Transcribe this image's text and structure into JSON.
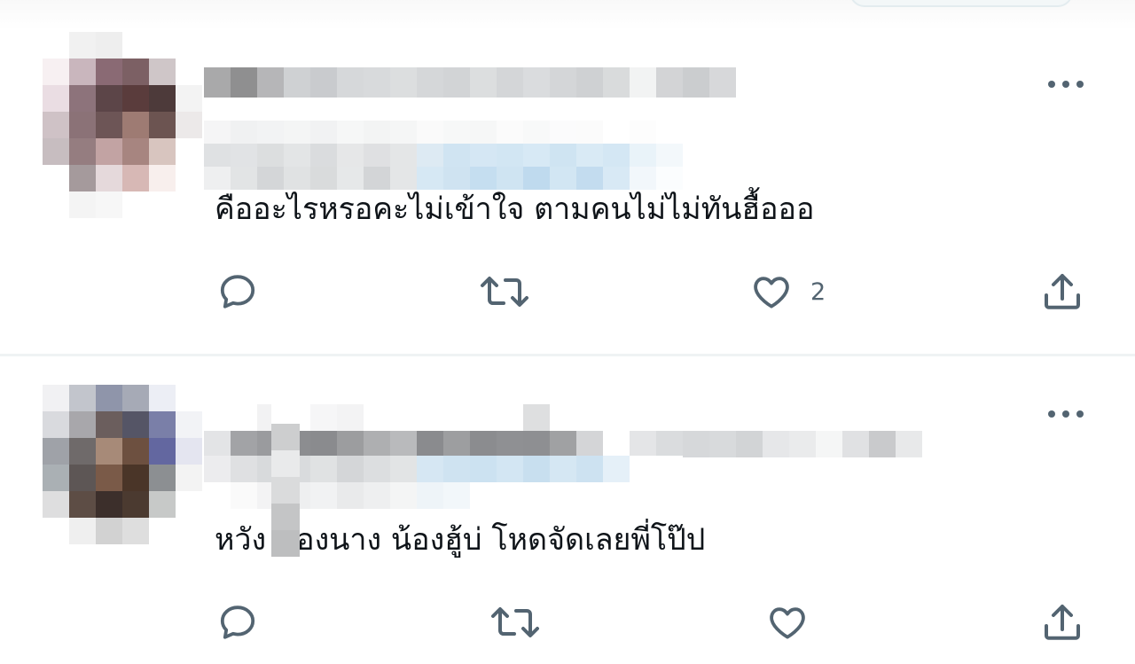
{
  "colors": {
    "icon_gray": "#536471",
    "text": "#0f1419",
    "separator": "#eff3f4"
  },
  "tweets": [
    {
      "author_name": "",
      "author_handle": "",
      "text": "คืออะไรหรอคะไม่เข้าใจ ตามคนไม่ไม่ทันฮื้อออ",
      "actions": {
        "reply_icon": "reply-icon",
        "retweet_icon": "retweet-icon",
        "like_icon": "like-icon",
        "like_count": "2",
        "share_icon": "share-icon"
      },
      "more_icon": "more-icon"
    },
    {
      "author_name": "",
      "author_handle": "",
      "text": "หวัง น้องนาง น้องฮู้บ่ โหดจัดเลยพี่โป๊ป",
      "actions": {
        "reply_icon": "reply-icon",
        "retweet_icon": "retweet-icon",
        "like_icon": "like-icon",
        "like_count": "",
        "share_icon": "share-icon"
      },
      "more_icon": "more-icon"
    }
  ]
}
